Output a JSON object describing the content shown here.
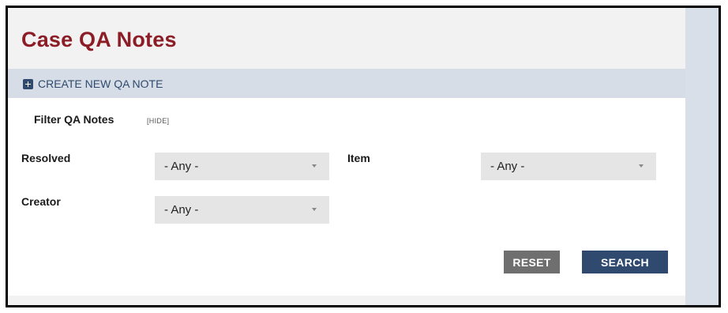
{
  "page": {
    "title": "Case QA Notes"
  },
  "actions": {
    "create_label": "CREATE NEW QA NOTE"
  },
  "filter": {
    "heading": "Filter QA Notes",
    "hide_label": "[HIDE]",
    "fields": {
      "resolved": {
        "label": "Resolved",
        "value": "- Any -"
      },
      "item": {
        "label": "Item",
        "value": "- Any -"
      },
      "creator": {
        "label": "Creator",
        "value": "- Any -"
      }
    },
    "buttons": {
      "reset": "RESET",
      "search": "SEARCH"
    }
  },
  "icons": {
    "create": "plus-square-icon",
    "dropdown": "chevron-down-icon"
  },
  "colors": {
    "title": "#8c1d26",
    "accent": "#2f4a6e",
    "reset_button": "#6f6f6f",
    "bar": "#d6dde7"
  }
}
